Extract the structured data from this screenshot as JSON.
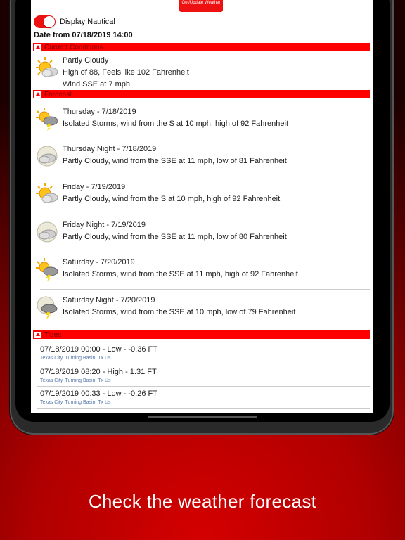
{
  "header": {
    "update_button": "Get/Update Weather",
    "nautical_label": "Display Nautical",
    "date_from": "Date from 07/18/2019 14:00"
  },
  "current": {
    "section_label": "Current Conditions",
    "condition": "Partly Cloudy",
    "temp": "High of 88, Feels like 102 Fahrenheit",
    "wind": "Wind SSE at 7 mph",
    "icon": "partly-cloudy-icon"
  },
  "forecast": {
    "section_label": "Forecast",
    "items": [
      {
        "title": "Thursday - 7/18/2019",
        "desc": "Isolated Storms, wind from the S at 10 mph, high of 92 Fahrenheit",
        "icon": "storm-sun-icon"
      },
      {
        "title": "Thursday Night - 7/18/2019",
        "desc": "Partly Cloudy, wind from the SSE at 11 mph, low of 81 Fahrenheit",
        "icon": "partly-cloudy-night-icon"
      },
      {
        "title": "Friday - 7/19/2019",
        "desc": "Partly Cloudy, wind from the S at 10 mph, high of 92 Fahrenheit",
        "icon": "partly-cloudy-icon"
      },
      {
        "title": "Friday Night - 7/19/2019",
        "desc": "Partly Cloudy, wind from the SSE at 11 mph, low of 80 Fahrenheit",
        "icon": "partly-cloudy-night-icon"
      },
      {
        "title": "Saturday - 7/20/2019",
        "desc": "Isolated Storms, wind from the SSE at 11 mph, high of 92 Fahrenheit",
        "icon": "storm-sun-icon"
      },
      {
        "title": "Saturday Night - 7/20/2019",
        "desc": "Isolated Storms, wind from the SSE at 10 mph, low of 79 Fahrenheit",
        "icon": "storm-night-icon"
      }
    ]
  },
  "tides": {
    "section_label": "Tides",
    "items": [
      {
        "line": "07/18/2019 00:00 - Low - -0.36 FT",
        "location": "Texas City, Turning Basin, Tx Us"
      },
      {
        "line": "07/18/2019 08:20 - High - 1.31 FT",
        "location": "Texas City, Turning Basin, Tx Us"
      },
      {
        "line": "07/19/2019 00:33 - Low - -0.26 FT",
        "location": "Texas City, Turning Basin, Tx Us"
      }
    ]
  },
  "caption": "Check the weather forecast",
  "colors": {
    "accent": "#ff0000",
    "toggle": "#ee1111",
    "tide_location": "#5577aa"
  }
}
